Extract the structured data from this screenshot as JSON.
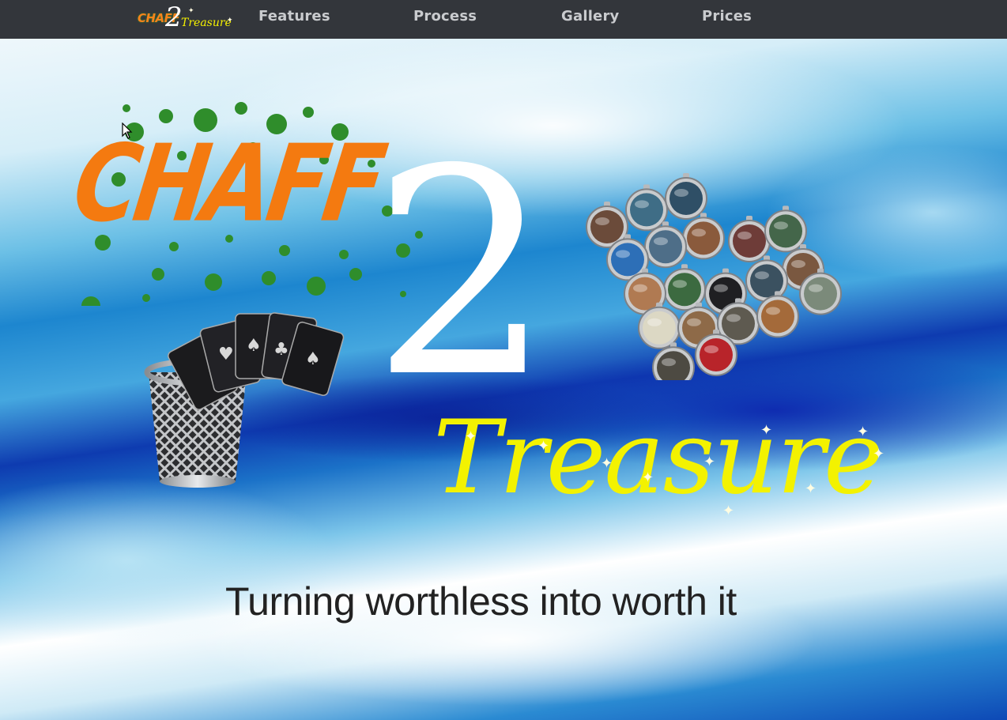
{
  "nav": {
    "logo": {
      "chaff": "CHAFF",
      "two": "2",
      "treasure": "Treasure"
    },
    "items": [
      {
        "label": "Features"
      },
      {
        "label": "Process"
      },
      {
        "label": "Gallery"
      },
      {
        "label": "Prices"
      }
    ]
  },
  "hero": {
    "logo": {
      "chaff": "CHAFF",
      "two": "2",
      "treasure": "Treasure"
    },
    "tagline": "Turning worthless into worth it"
  },
  "colors": {
    "nav_bg": "#33363b",
    "nav_text": "#c9cbce",
    "chaff_orange": "#f47a10",
    "splatter_green": "#2f8d2b",
    "treasure_yellow": "#f3f200",
    "tagline_text": "#222222"
  },
  "icons": [
    "trash-bin-icon",
    "playing-cards-icon",
    "mouse-cursor-icon",
    "sparkle-icon"
  ]
}
